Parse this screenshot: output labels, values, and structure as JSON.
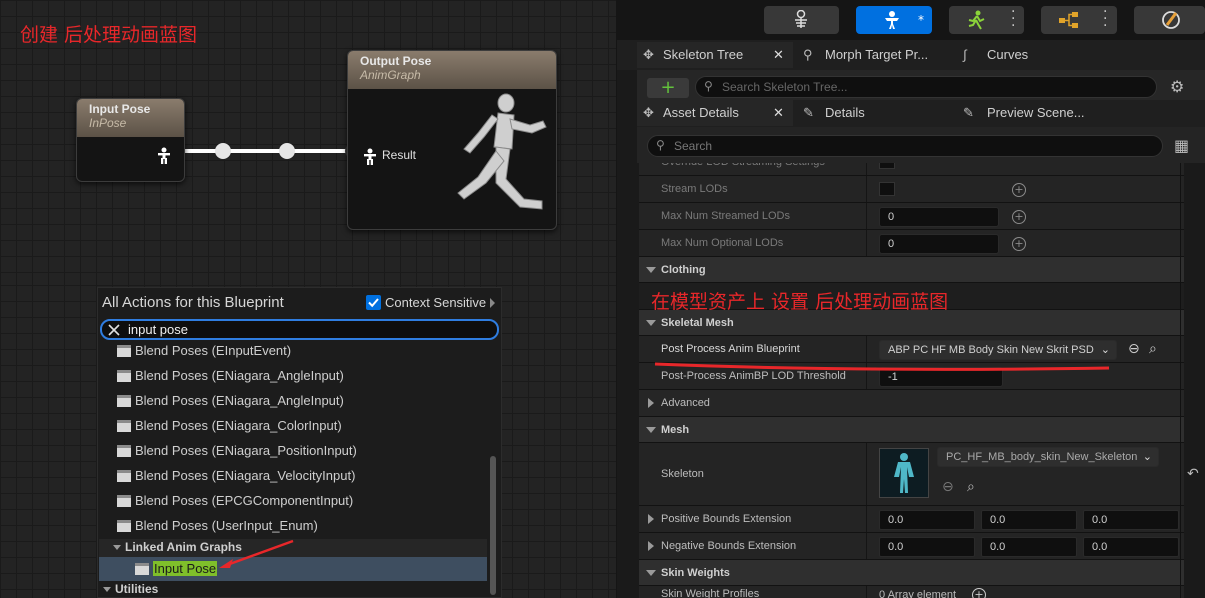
{
  "annotations": {
    "top_left": "创建 后处理动画蓝图",
    "right": "在模型资产上 设置 后处理动画蓝图"
  },
  "graph": {
    "input_node": {
      "title": "Input Pose",
      "subtitle": "InPose"
    },
    "output_node": {
      "title": "Output Pose",
      "subtitle": "AnimGraph",
      "pin_label": "Result"
    }
  },
  "action_menu": {
    "title": "All Actions for this Blueprint",
    "context_sensitive_label": "Context Sensitive",
    "context_sensitive_checked": true,
    "search_value": "input pose",
    "items": [
      "Blend Poses (EInputEvent)",
      "Blend Poses (ENiagara_AngleInput)",
      "Blend Poses (ENiagara_AngleInput)",
      "Blend Poses (ENiagara_ColorInput)",
      "Blend Poses (ENiagara_PositionInput)",
      "Blend Poses (ENiagara_VelocityInput)",
      "Blend Poses (EPCGComponentInput)",
      "Blend Poses (UserInput_Enum)"
    ],
    "category_linked": "Linked Anim Graphs",
    "selected_item": "Input Pose",
    "category_utilities": "Utilities"
  },
  "toolbar": {
    "icons": [
      "skeleton-icon",
      "mesh-icon",
      "animation-icon",
      "blueprint-icon",
      "physics-icon"
    ]
  },
  "tabs_top": {
    "skeleton_tree": "Skeleton Tree",
    "morph_target": "Morph Target Pr...",
    "curves": "Curves",
    "search_placeholder": "Search Skeleton Tree..."
  },
  "tabs_details": {
    "asset_details": "Asset Details",
    "details": "Details",
    "preview_scene": "Preview Scene...",
    "search_placeholder": "Search"
  },
  "properties": {
    "partial_row": "Override LOD Streaming Settings",
    "stream_lods": "Stream LODs",
    "max_streamed": {
      "label": "Max Num Streamed LODs",
      "value": "0"
    },
    "max_optional": {
      "label": "Max Num Optional LODs",
      "value": "0"
    },
    "cat_clothing": "Clothing",
    "cat_skeletal_mesh": "Skeletal Mesh",
    "post_process": {
      "label": "Post Process Anim Blueprint",
      "value": "ABP PC HF MB Body Skin New Skrit PSD"
    },
    "lod_threshold": {
      "label": "Post-Process AnimBP LOD Threshold",
      "value": "-1"
    },
    "cat_advanced": "Advanced",
    "cat_mesh": "Mesh",
    "skeleton": {
      "label": "Skeleton",
      "value": "PC_HF_MB_body_skin_New_Skeleton"
    },
    "positive_bounds": {
      "label": "Positive Bounds Extension",
      "values": [
        "0.0",
        "0.0",
        "0.0"
      ]
    },
    "negative_bounds": {
      "label": "Negative Bounds Extension",
      "values": [
        "0.0",
        "0.0",
        "0.0"
      ]
    },
    "cat_skin_weights": "Skin Weights",
    "skin_weight_profiles": {
      "label": "Skin Weight Profiles",
      "value": "0 Array element"
    }
  },
  "colors": {
    "accent_blue": "#0070e0",
    "annotation_red": "#e8272a",
    "selected_highlight": "#7fbf2a",
    "node_header": "#8a7c6d"
  }
}
